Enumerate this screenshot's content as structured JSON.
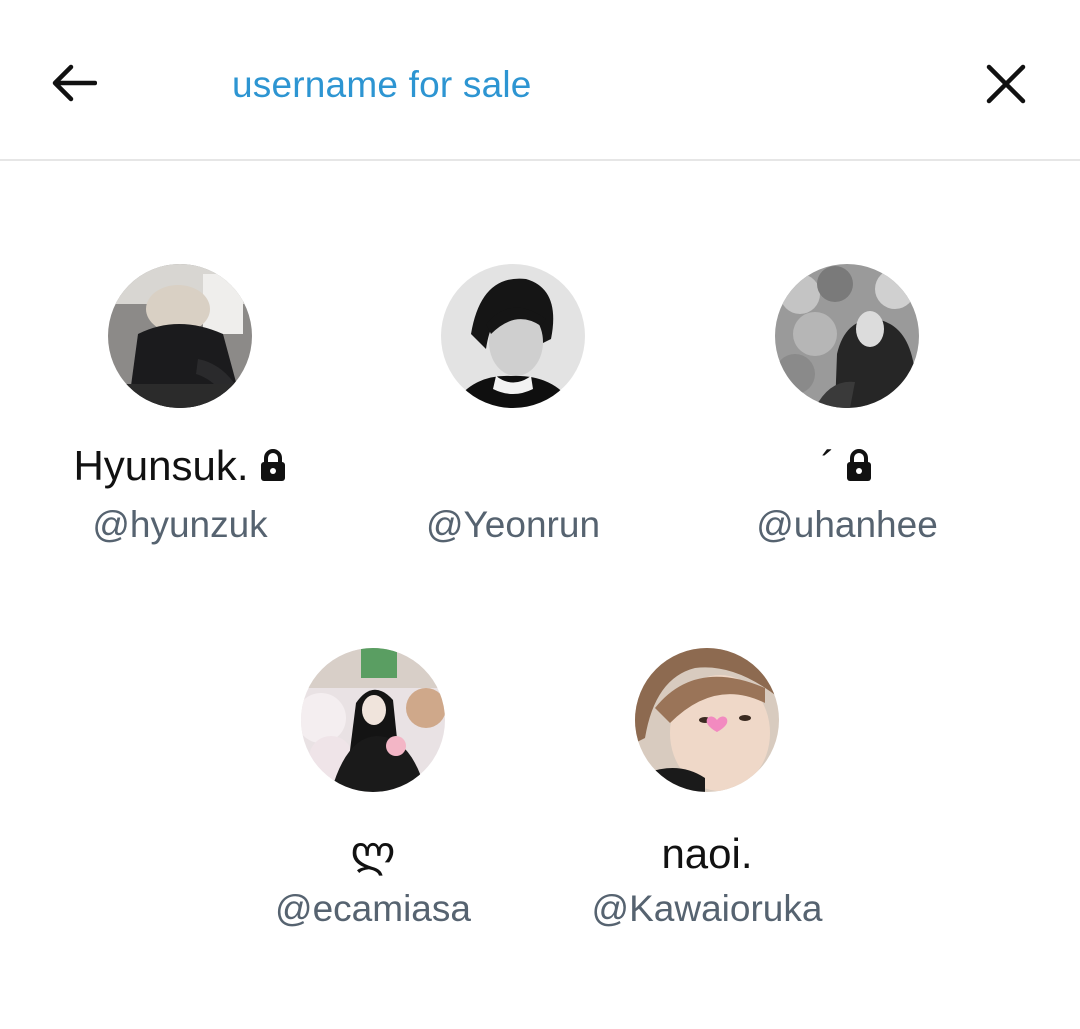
{
  "header": {
    "search_query": "username for sale",
    "back_icon": "arrow-left-icon",
    "close_icon": "close-icon"
  },
  "colors": {
    "accent": "#2d95d2",
    "handle": "#566370",
    "divider": "#e6e6e6"
  },
  "users": [
    {
      "display_name": "Hyunsuk.",
      "handle": "@hyunzuk",
      "protected": true
    },
    {
      "display_name": "",
      "handle": "@Yeonrun",
      "protected": false
    },
    {
      "display_name": "´",
      "handle": "@uhanhee",
      "protected": true
    },
    {
      "display_name": "ლ",
      "handle": "@ecamiasa",
      "protected": false
    },
    {
      "display_name": "naoi.",
      "handle": "@Kawaioruka",
      "protected": false
    }
  ]
}
